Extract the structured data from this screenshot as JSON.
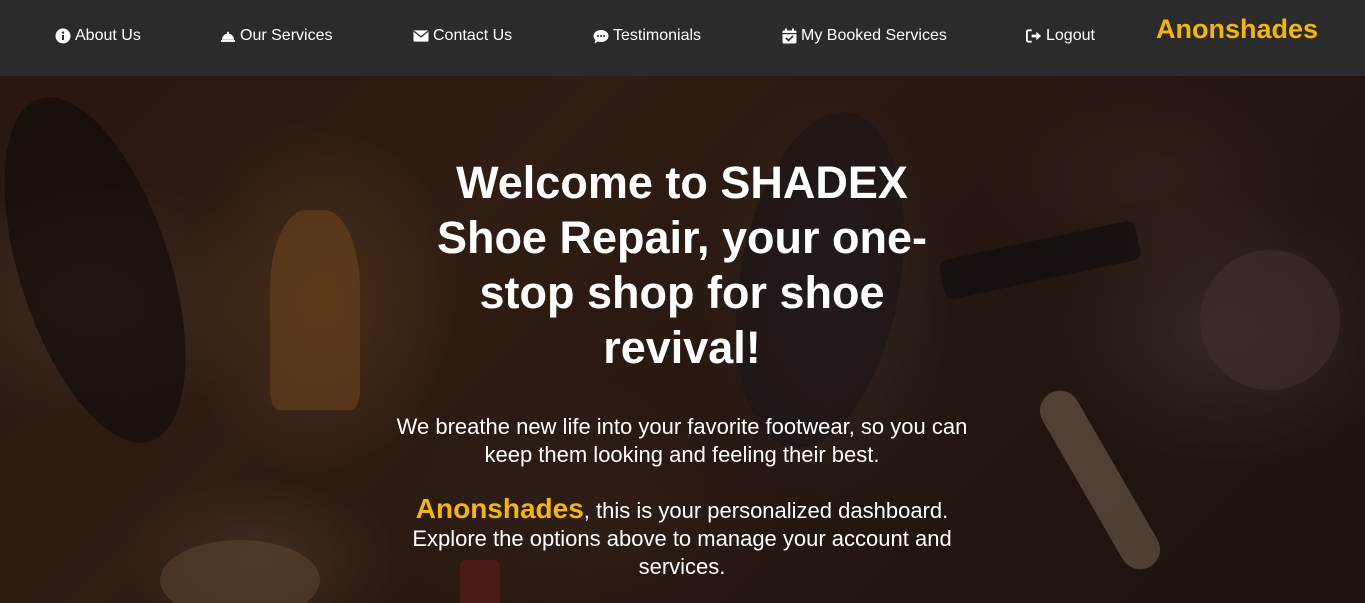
{
  "nav": {
    "items": [
      {
        "label": "About Us",
        "icon": "info-icon"
      },
      {
        "label": "Our Services",
        "icon": "service-bell-icon"
      },
      {
        "label": "Contact Us",
        "icon": "envelope-icon"
      },
      {
        "label": "Testimonials",
        "icon": "comment-icon"
      },
      {
        "label": "My Booked Services",
        "icon": "calendar-check-icon"
      },
      {
        "label": "Logout",
        "icon": "sign-out-icon"
      }
    ],
    "brand": "Anonshades"
  },
  "hero": {
    "title": "Welcome to SHADEX Shoe Repair, your one-stop shop for shoe revival!",
    "tagline": "We breathe new life into your favorite footwear, so you can keep them looking and feeling their best.",
    "user_name": "Anonshades",
    "dashboard_text": ", this is your personalized dashboard. Explore the options above to manage your account and services."
  },
  "colors": {
    "accent": "#f5b50a",
    "navbar_bg": "#2b2b2b",
    "text": "#ffffff"
  }
}
